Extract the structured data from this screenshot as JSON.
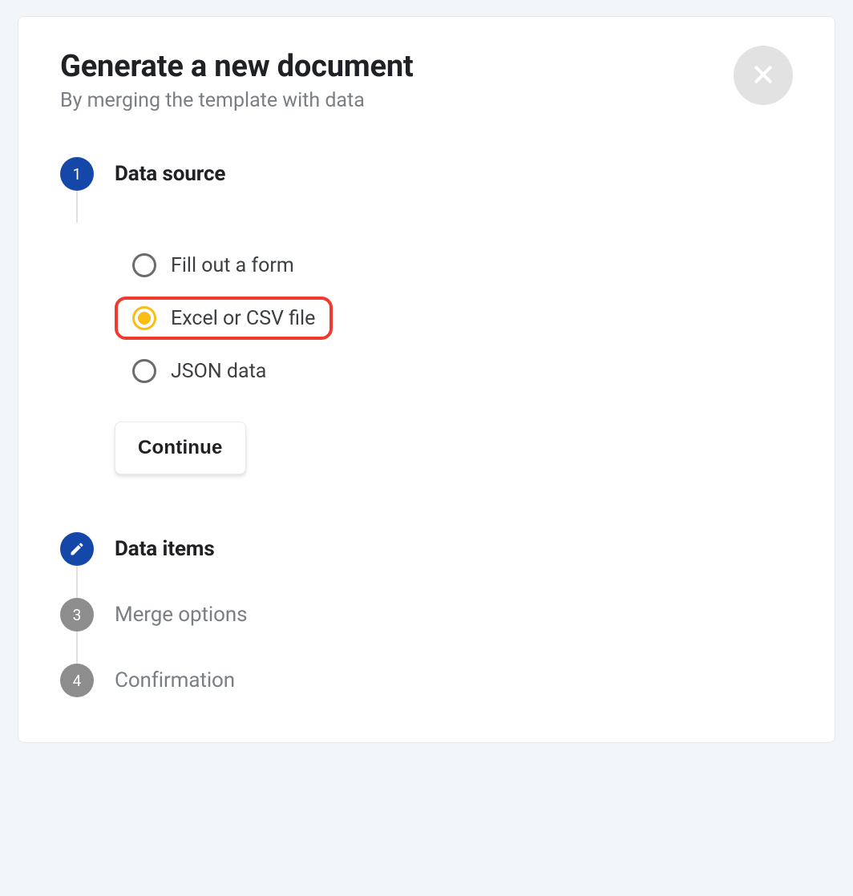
{
  "dialog": {
    "title": "Generate a new document",
    "subtitle": "By merging the template with data"
  },
  "steps": {
    "s1": {
      "num": "1",
      "title": "Data source"
    },
    "s2": {
      "title": "Data items"
    },
    "s3": {
      "num": "3",
      "title": "Merge options"
    },
    "s4": {
      "num": "4",
      "title": "Confirmation"
    }
  },
  "radios": {
    "form": "Fill out a form",
    "excel": "Excel or CSV file",
    "json": "JSON data"
  },
  "buttons": {
    "continue": "Continue"
  },
  "colors": {
    "accent": "#1447a8",
    "highlight": "#f03a2f",
    "radio_selected": "#fabd14"
  }
}
